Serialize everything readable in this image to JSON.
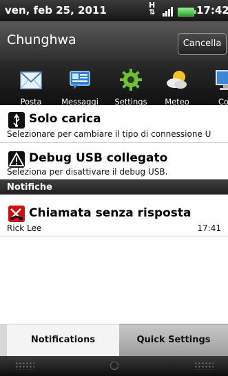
{
  "status_bar": {
    "date": "ven, feb 25, 2011",
    "time": "17:42",
    "network": "H"
  },
  "header": {
    "operator": "Chunghwa",
    "cancel_label": "Cancella"
  },
  "apps": [
    {
      "label": "Posta",
      "icon": "mail-icon"
    },
    {
      "label": "Messaggi",
      "icon": "messages-icon"
    },
    {
      "label": "Settings",
      "icon": "gear-icon"
    },
    {
      "label": "Meteo",
      "icon": "weather-icon"
    },
    {
      "label": "Con",
      "icon": "computer-icon"
    }
  ],
  "ongoing": [
    {
      "title": "Solo carica",
      "description": "Selezionare per cambiare il tipo di connessione U",
      "icon": "usb-icon"
    },
    {
      "title": "Debug USB collegato",
      "description": "Seleziona per disattivare il debug USB.",
      "icon": "warning-icon"
    }
  ],
  "notifications_header": "Notifiche",
  "notifications": [
    {
      "title": "Chiamata senza risposta",
      "caller": "Rick Lee",
      "time": "17:41",
      "icon": "missed-call-icon"
    }
  ],
  "tabs": {
    "notifications": "Notifications",
    "quick_settings": "Quick Settings"
  },
  "colors": {
    "accent_green": "#35b235",
    "missed_call_red": "#cc1111"
  }
}
